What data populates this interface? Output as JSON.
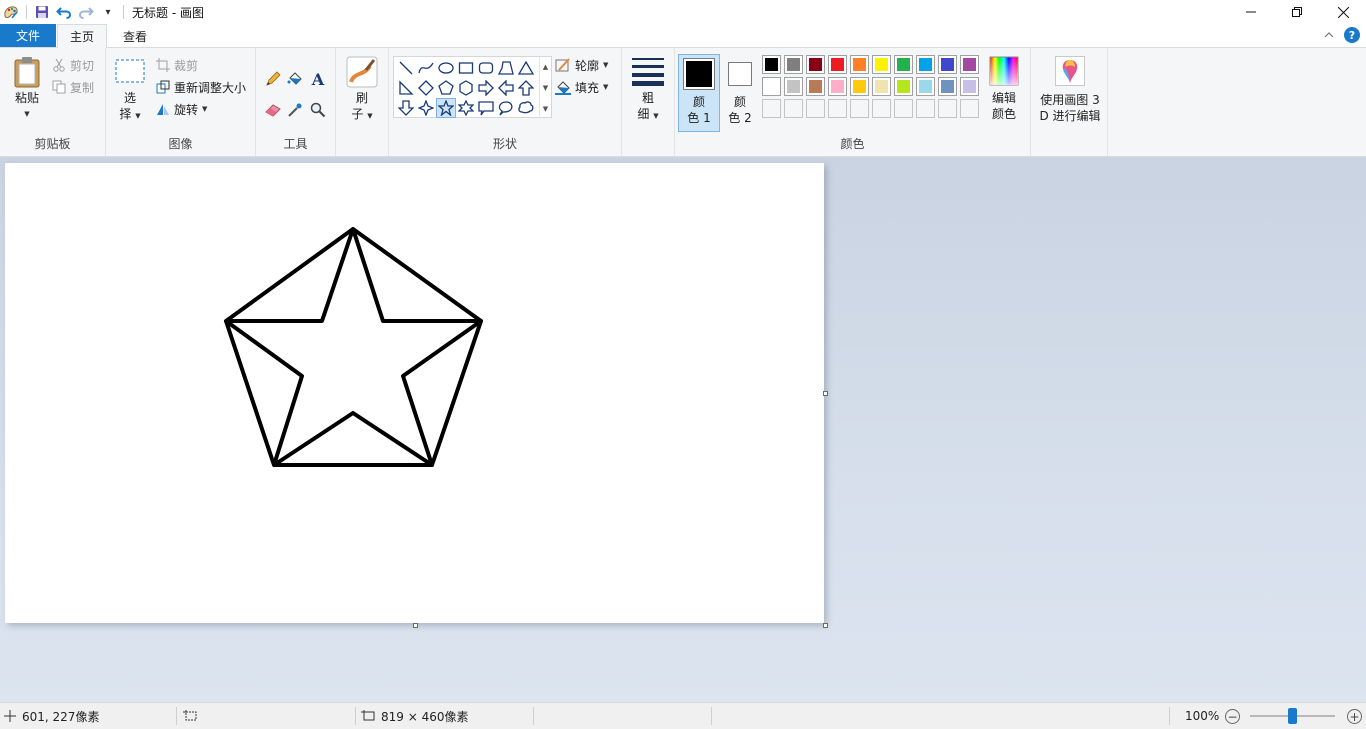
{
  "window": {
    "title": "无标题 - 画图",
    "qa_more": "▾"
  },
  "tabs": {
    "file": "文件",
    "home": "主页",
    "view": "查看"
  },
  "ribbon": {
    "clipboard": {
      "group_label": "剪贴板",
      "paste": "粘贴",
      "cut": "剪切",
      "copy": "复制"
    },
    "image": {
      "group_label": "图像",
      "select_line1": "选",
      "select_line2": "择",
      "crop": "裁剪",
      "resize": "重新调整大小",
      "rotate": "旋转"
    },
    "tools": {
      "group_label": "工具",
      "pencil_icon": "pencil-icon",
      "fill_icon": "paint-bucket-icon",
      "text_icon": "text-icon",
      "eraser_icon": "eraser-icon",
      "picker_icon": "color-picker-icon",
      "magnifier_icon": "magnifier-icon"
    },
    "brushes": {
      "line1": "刷",
      "line2": "子"
    },
    "shapes": {
      "group_label": "形状",
      "outline": "轮廓",
      "fill": "填充",
      "selected": "star5"
    },
    "size": {
      "line1": "粗",
      "line2": "细"
    },
    "colors": {
      "group_label": "颜色",
      "color1_line1": "颜",
      "color1_line2": "色 1",
      "color2_line1": "颜",
      "color2_line2": "色 2",
      "color1_value": "#000000",
      "color2_value": "#ffffff",
      "edit_line1": "编辑",
      "edit_line2": "颜色",
      "palette_row1": [
        "#000000",
        "#7f7f7f",
        "#880015",
        "#ed1c24",
        "#ff7f27",
        "#fff200",
        "#22b14c",
        "#00a2e8",
        "#3f48cc",
        "#a349a4"
      ],
      "palette_row2": [
        "#ffffff",
        "#c3c3c3",
        "#b97a57",
        "#ffaec9",
        "#ffc90e",
        "#efe4b0",
        "#b5e61d",
        "#99d9ea",
        "#7092be",
        "#c8bfe7"
      ]
    },
    "paint3d": {
      "line1": "使用画图 3",
      "line2": "D 进行编辑"
    }
  },
  "status": {
    "cursor_pos": "601, 227像素",
    "image_size": "819 × 460像素",
    "zoom": "100%",
    "zoom_value": 1.0
  }
}
